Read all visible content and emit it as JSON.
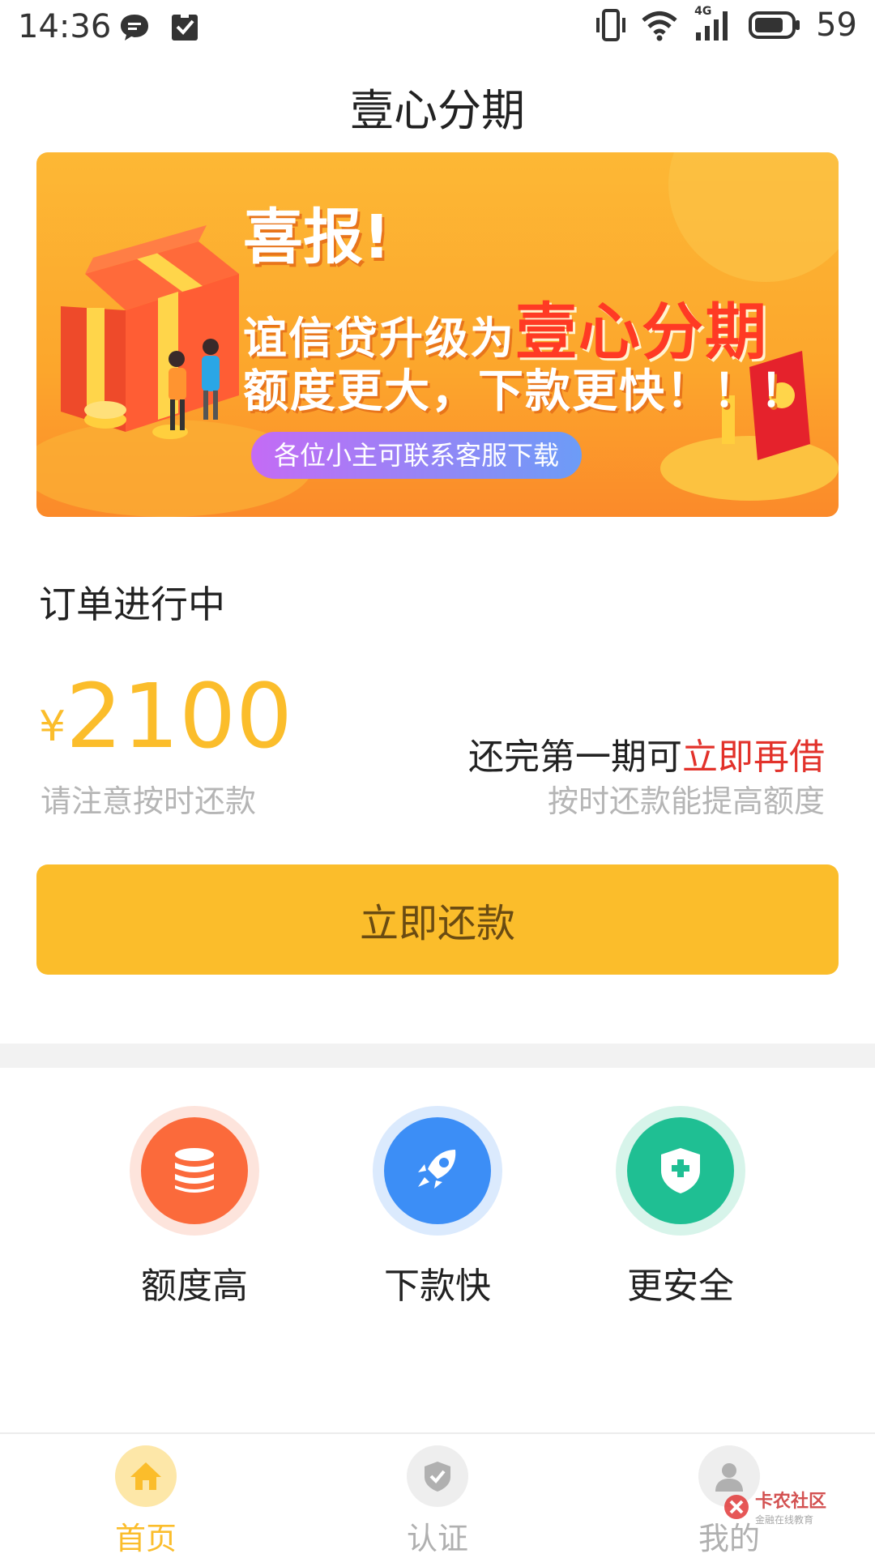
{
  "status_bar": {
    "time": "14:36",
    "battery": "59",
    "network": "4G"
  },
  "header": {
    "title": "壹心分期"
  },
  "banner": {
    "headline": "喜报!",
    "line2_prefix": "谊信贷升级为",
    "line2_brand": "壹心分期",
    "line3": "额度更大，下款更快！！！",
    "pill": "各位小主可联系客服下载"
  },
  "order": {
    "status": "订单进行中",
    "currency": "¥",
    "amount": "2100",
    "amount_note": "请注意按时还款",
    "reborrow_prefix": "还完第一期可",
    "reborrow_link": "立即再借",
    "reborrow_note": "按时还款能提高额度",
    "repay_button": "立即还款"
  },
  "features": [
    {
      "label": "额度高",
      "icon": "coin-stack-icon",
      "color": "#fb6a3b"
    },
    {
      "label": "下款快",
      "icon": "rocket-icon",
      "color": "#3c8ef6"
    },
    {
      "label": "更安全",
      "icon": "shield-plus-icon",
      "color": "#1fbf93"
    }
  ],
  "tab_bar": {
    "tabs": [
      {
        "label": "首页",
        "icon": "home-icon",
        "active": true
      },
      {
        "label": "认证",
        "icon": "shield-check-icon",
        "active": false
      },
      {
        "label": "我的",
        "icon": "user-icon",
        "active": false
      }
    ],
    "active_color": "#fbbd2b",
    "inactive_color": "#b0b0b0"
  },
  "watermark": {
    "text": "卡农社区",
    "subtext": "金融在线教育"
  }
}
